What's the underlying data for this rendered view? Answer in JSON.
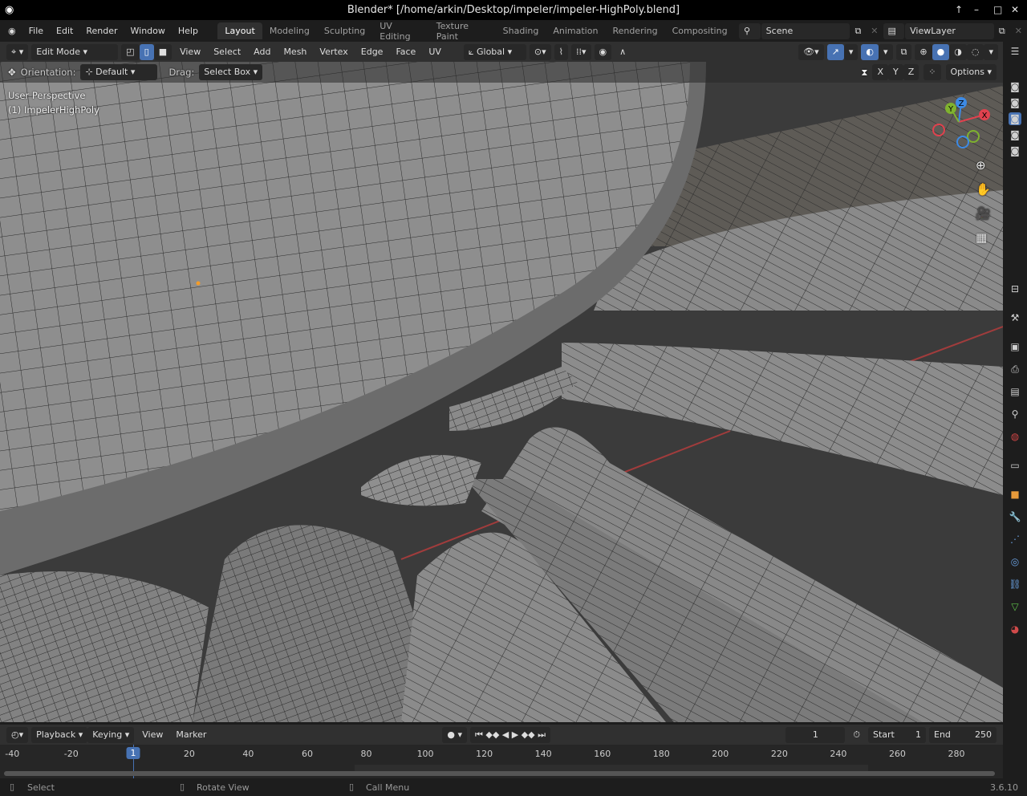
{
  "title": "Blender* [/home/arkin/Desktop/impeler/impeler-HighPoly.blend]",
  "menu": [
    "File",
    "Edit",
    "Render",
    "Window",
    "Help"
  ],
  "workspaces": [
    "Layout",
    "Modeling",
    "Sculpting",
    "UV Editing",
    "Texture Paint",
    "Shading",
    "Animation",
    "Rendering",
    "Compositing"
  ],
  "active_workspace": "Layout",
  "scene": "Scene",
  "view_layer": "ViewLayer",
  "viewport_header": {
    "mode": "Edit Mode",
    "menus": [
      "View",
      "Select",
      "Add",
      "Mesh",
      "Vertex",
      "Edge",
      "Face",
      "UV"
    ],
    "transform_orientation": "Global",
    "select_mode": "edge"
  },
  "tool_header": {
    "orientation_label": "Orientation:",
    "orientation": "Default",
    "drag_label": "Drag:",
    "drag": "Select Box",
    "axes": [
      "X",
      "Y",
      "Z"
    ],
    "options": "Options"
  },
  "overlay": {
    "view_name": "User Perspective",
    "object": "(1) ImpelerHighPoly"
  },
  "gizmo": {
    "x": "X",
    "y": "Y",
    "z": "Z",
    "colors": {
      "x": "#e0424e",
      "y": "#7fb22f",
      "z": "#3d8ae4"
    }
  },
  "timeline": {
    "menus": [
      "Playback",
      "Keying",
      "View",
      "Marker"
    ],
    "current_frame": "1",
    "start_label": "Start",
    "start": "1",
    "end_label": "End",
    "end": "250",
    "ticks": [
      "-40",
      "-20",
      "1",
      "20",
      "40",
      "60",
      "80",
      "100",
      "120",
      "140",
      "160",
      "180",
      "200",
      "220",
      "240",
      "260",
      "280"
    ]
  },
  "status": {
    "select": "Select",
    "rotate": "Rotate View",
    "menu": "Call Menu",
    "version": "3.6.10"
  },
  "accent": "#4772b3"
}
